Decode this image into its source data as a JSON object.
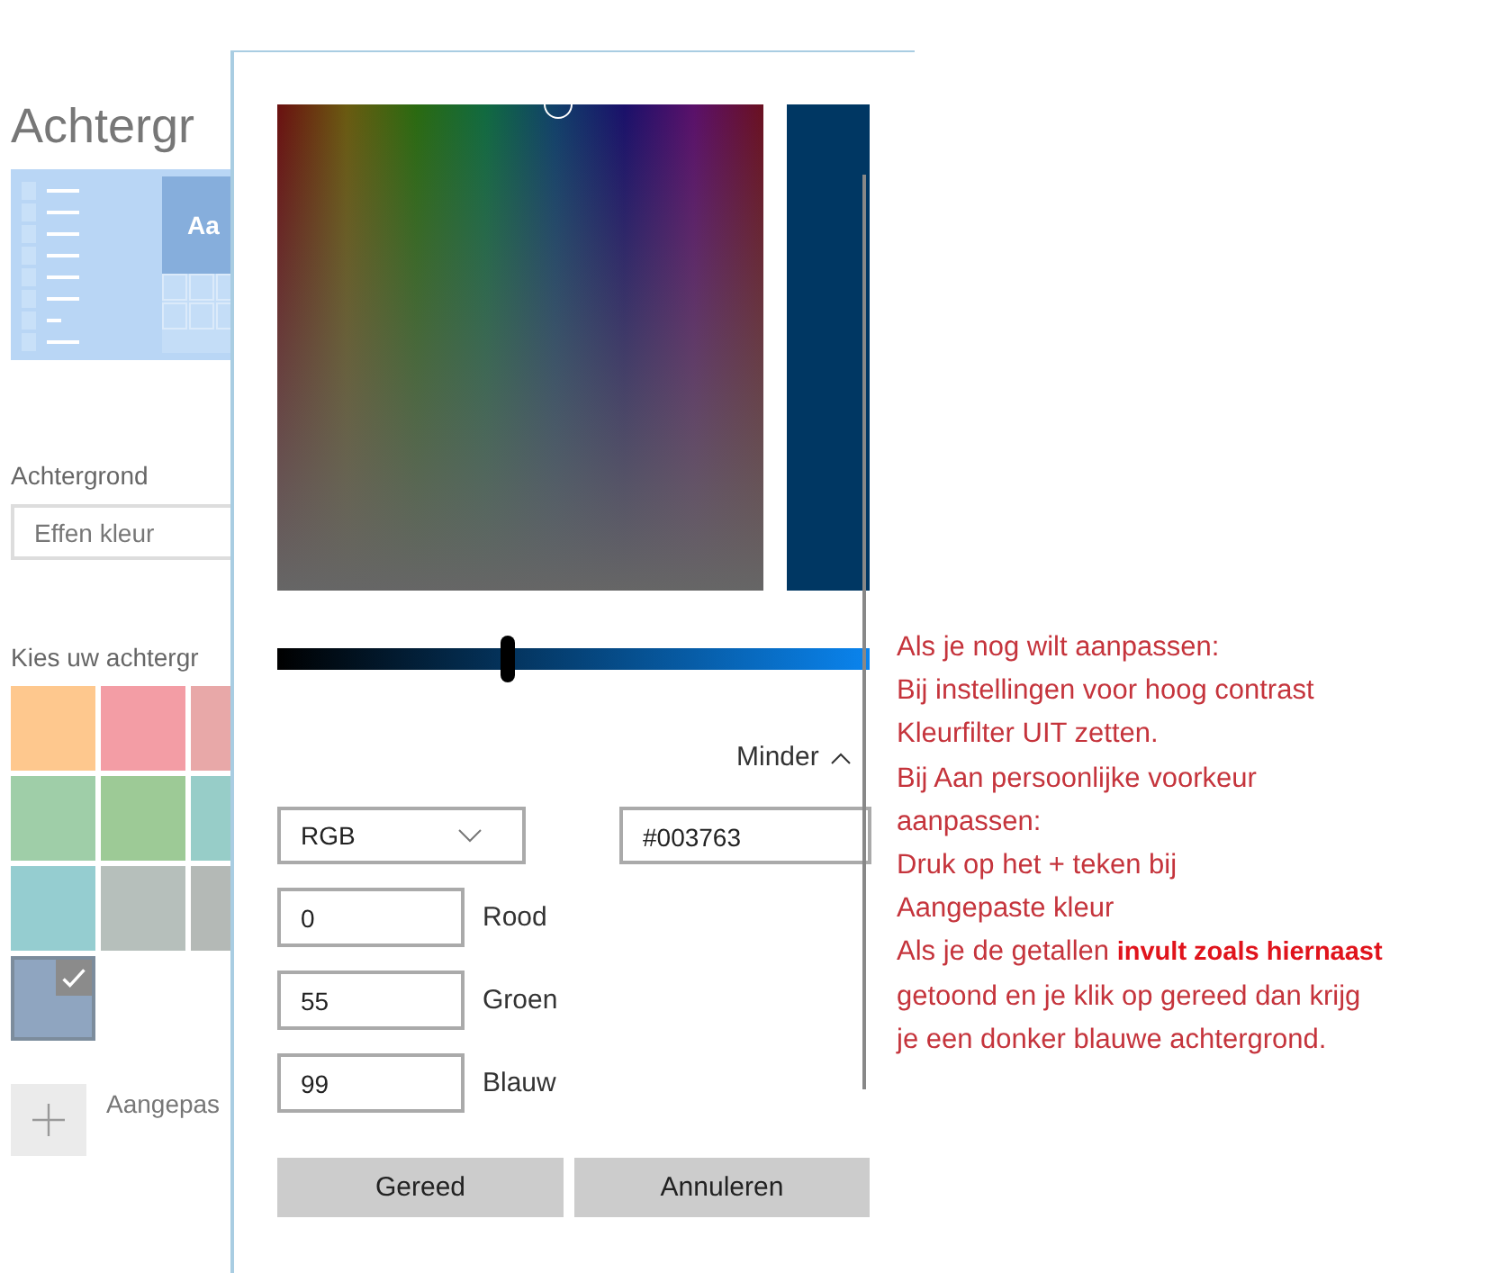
{
  "settings": {
    "title": "Achtergr",
    "preview_label": "Aa",
    "background_label": "Achtergrond",
    "background_value": "Effen kleur",
    "choose_label": "Kies uw achtergr",
    "swatches": [
      {
        "color": "#fec88e",
        "selected": false
      },
      {
        "color": "#f39da5",
        "selected": false
      },
      {
        "color": "#e8a8a8",
        "selected": false
      },
      {
        "color": "#9fcea8",
        "selected": false
      },
      {
        "color": "#9dca96",
        "selected": false
      },
      {
        "color": "#97cdc8",
        "selected": false
      },
      {
        "color": "#95cdd0",
        "selected": false
      },
      {
        "color": "#b6bfbb",
        "selected": false
      },
      {
        "color": "#b4b9b6",
        "selected": false
      },
      {
        "color": "#8fa5c0",
        "selected": true
      }
    ],
    "custom_label": "Aangepas"
  },
  "picker": {
    "slider": {
      "level": 0.39
    },
    "toggle_label": "Minder",
    "mode": "RGB",
    "hex": "#003763",
    "channels": [
      {
        "value": "0",
        "label": "Rood"
      },
      {
        "value": "55",
        "label": "Groen"
      },
      {
        "value": "99",
        "label": "Blauw"
      }
    ],
    "buttons": [
      "Gereed",
      "Annuleren"
    ]
  },
  "note": {
    "lines": [
      "Als je nog wilt aanpassen:",
      "Bij instellingen voor hoog contrast",
      "Kleurfilter UIT zetten.",
      "Bij Aan persoonlijke voorkeur",
      "aanpassen:",
      "Druk op het + teken bij",
      "Aangepaste kleur",
      "Als je de getallen **invult zoals hiernaast**",
      "getoond en je klik op gereed dan krijg",
      "je een donker blauwe achtergrond."
    ]
  }
}
